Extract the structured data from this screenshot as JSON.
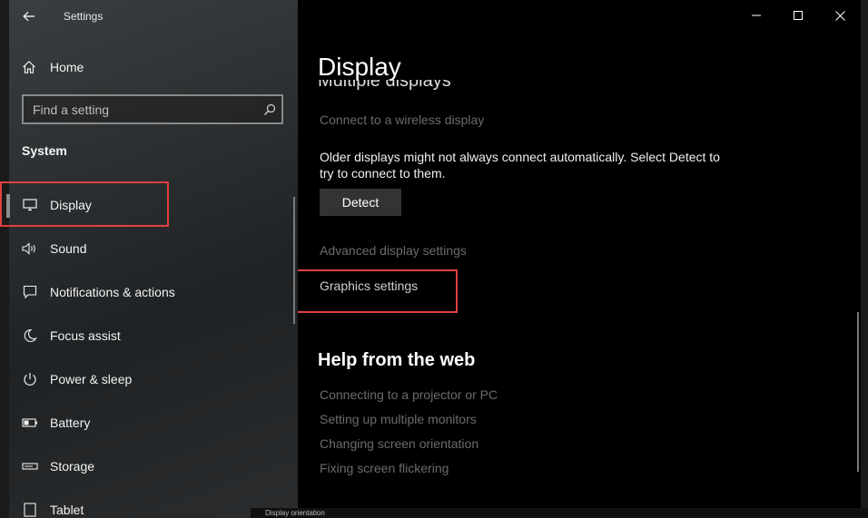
{
  "window": {
    "title": "Settings"
  },
  "sidebar": {
    "home_label": "Home",
    "search_placeholder": "Find a setting",
    "section_heading": "System",
    "items": [
      {
        "label": "Display",
        "icon": "monitor-icon",
        "selected": true
      },
      {
        "label": "Sound",
        "icon": "speaker-icon"
      },
      {
        "label": "Notifications & actions",
        "icon": "notification-icon"
      },
      {
        "label": "Focus assist",
        "icon": "moon-icon"
      },
      {
        "label": "Power & sleep",
        "icon": "power-icon"
      },
      {
        "label": "Battery",
        "icon": "battery-icon"
      },
      {
        "label": "Storage",
        "icon": "storage-icon"
      },
      {
        "label": "Tablet",
        "icon": "tablet-icon"
      }
    ]
  },
  "main": {
    "page_title": "Display",
    "cut_header": "Multiple displays",
    "wireless_link": "Connect to a wireless display",
    "detect_description": "Older displays might not always connect automatically. Select Detect to try to connect to them.",
    "detect_button": "Detect",
    "advanced_link": "Advanced display settings",
    "graphics_link": "Graphics settings",
    "help_title": "Help from the web",
    "help_links": [
      "Connecting to a projector or PC",
      "Setting up multiple monitors",
      "Changing screen orientation",
      "Fixing screen flickering"
    ]
  },
  "taskbar_caption": "Display orientation",
  "colors": {
    "highlight_outline": "#e04040",
    "dim_link": "#6b6b6b"
  }
}
